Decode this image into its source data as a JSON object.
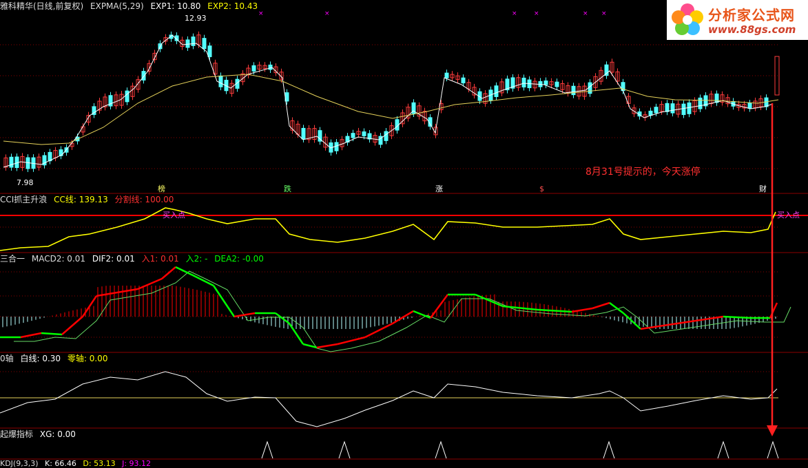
{
  "colors": {
    "background": "#000000",
    "grid_red": "#8b0000",
    "candle_up": "#ff3c3c",
    "candle_down": "#53ffff",
    "yellow": "#ffff00",
    "red": "#ff0000",
    "green": "#00ff00",
    "magenta": "#ff00ff",
    "white": "#ffffff"
  },
  "main_panel": {
    "stock_title": "雅科精华(日线,前复权)",
    "indicator_name": "EXPMA(5,29)",
    "exp1": "EXP1: 10.80",
    "exp2": "EXP2: 10.43",
    "high_marker": "12.93",
    "low_marker": "7.98",
    "annotation": "8月31号提示的，今天涨停",
    "event_markers": [
      "榜",
      "跌",
      "涨",
      "$",
      "财"
    ]
  },
  "cci_panel": {
    "title": "CCI抓主升浪",
    "cc_line": "CC线: 139.13",
    "split_line": "分割线: 100.00",
    "buy_label_1": "买入点",
    "buy_label_2": "买入点"
  },
  "macd_panel": {
    "title": "三合一",
    "macd2": "MACD2: 0.01",
    "dif2": "DIF2: 0.01",
    "in1": "入1: 0.01",
    "in2": "入2: -",
    "dea2": "DEA2: -0.00"
  },
  "zero_panel": {
    "title": "0轴",
    "white_line": "白线: 0.30",
    "zero_line": "零轴: 0.00"
  },
  "xg_panel": {
    "title": "起爆指标",
    "xg": "XG: 0.00"
  },
  "kdj_panel": {
    "title": "KDJ(9,3,3)",
    "k": "K: 66.46",
    "d": "D: 53.13",
    "j": "J: 93.12"
  },
  "logo": {
    "name": "分析家公式网",
    "url": "www.88gs.com"
  }
}
